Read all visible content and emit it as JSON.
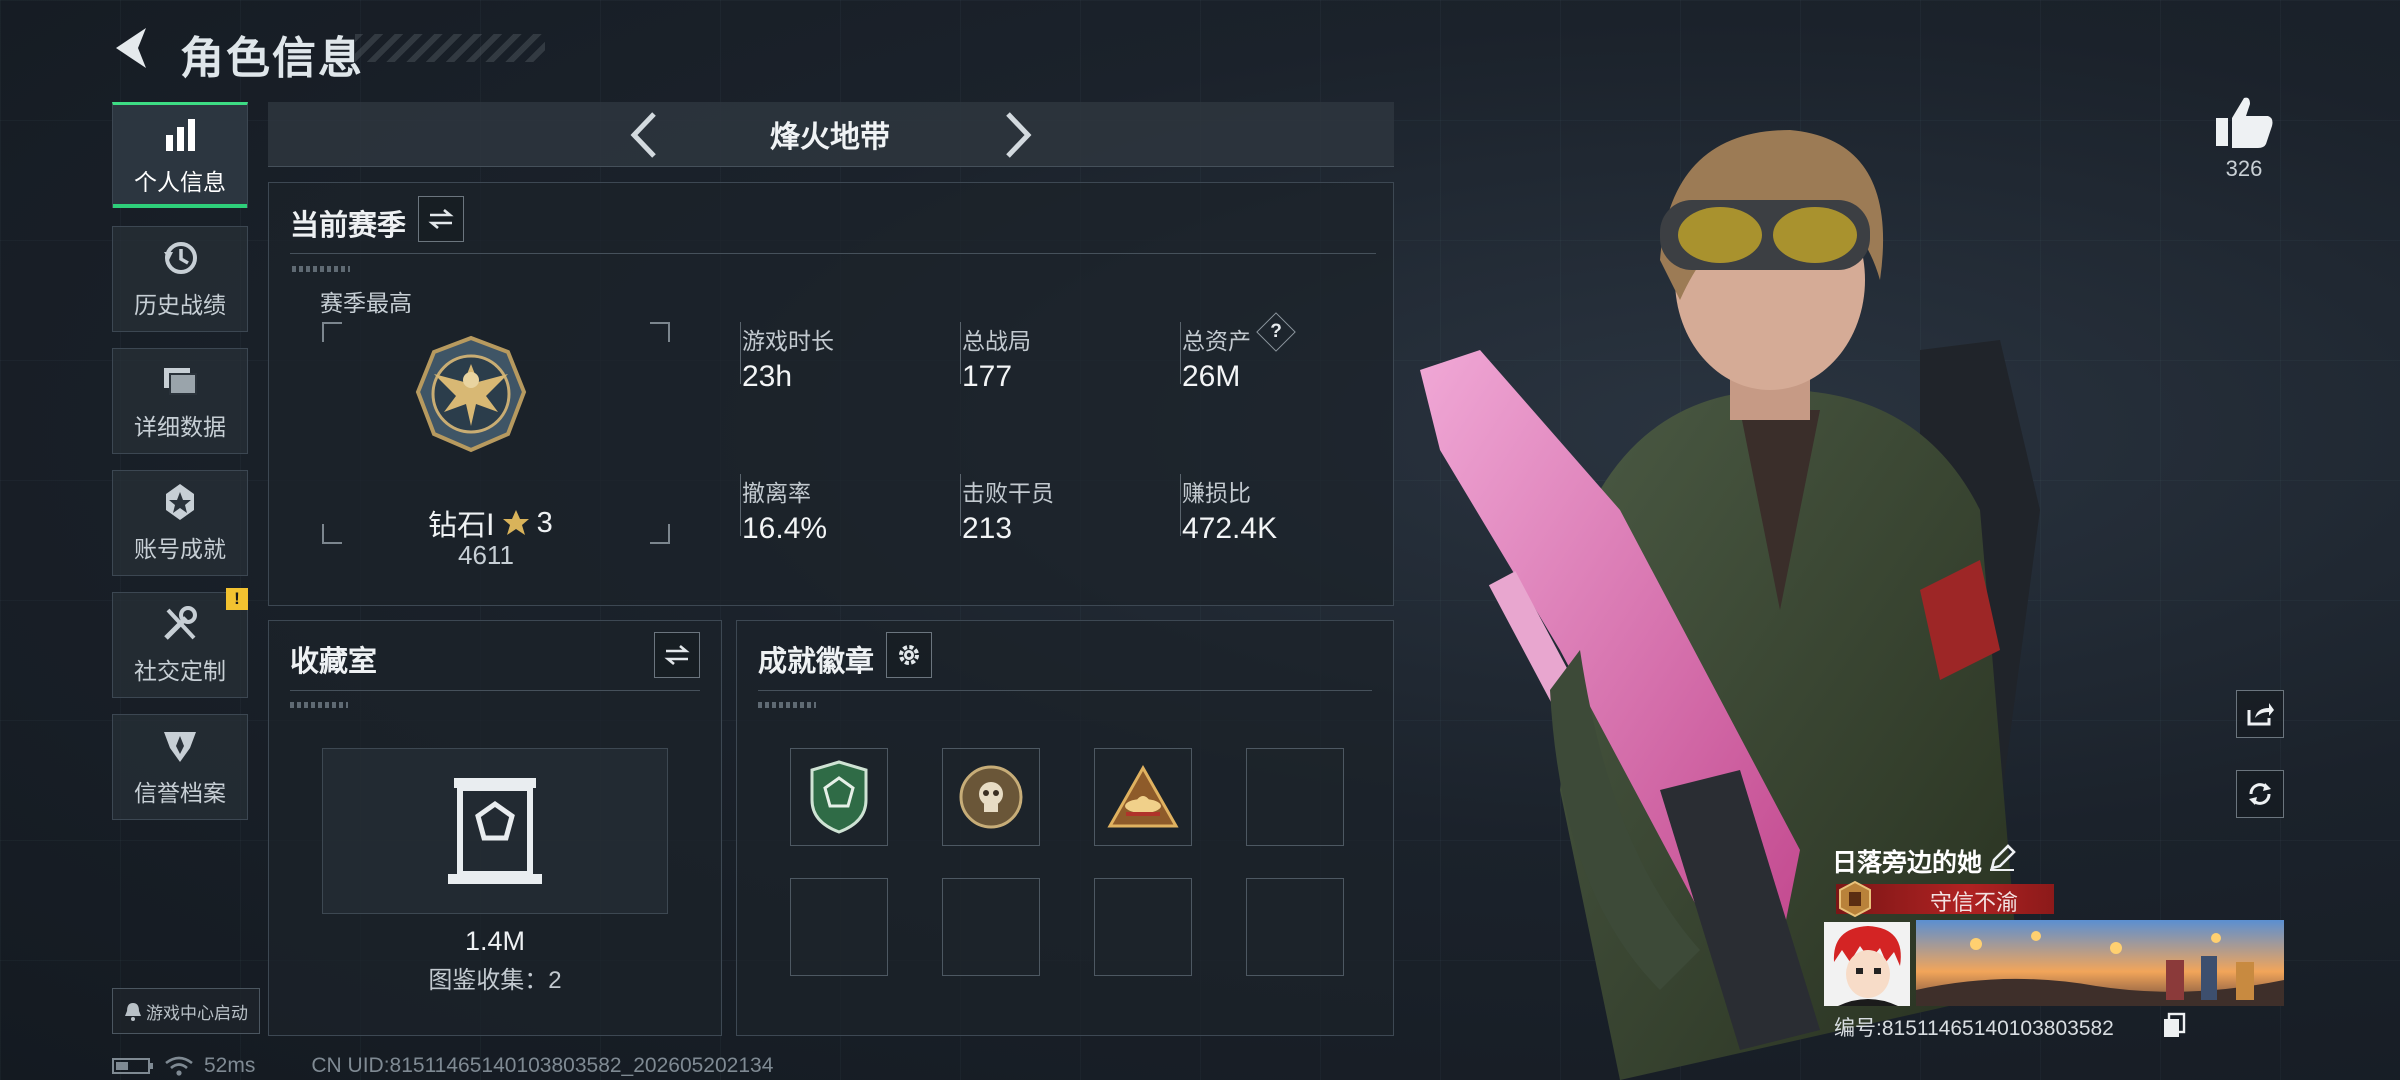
{
  "header": {
    "title": "角色信息"
  },
  "nav": {
    "items": [
      {
        "label": "个人信息",
        "icon": "bar-chart-icon",
        "active": true
      },
      {
        "label": "历史战绩",
        "icon": "history-clock-icon",
        "active": false
      },
      {
        "label": "详细数据",
        "icon": "folder-icon",
        "active": false
      },
      {
        "label": "账号成就",
        "icon": "achievement-star-icon",
        "active": false
      },
      {
        "label": "社交定制",
        "icon": "tools-icon",
        "active": false
      },
      {
        "label": "信誉档案",
        "icon": "credit-shield-icon",
        "active": false
      }
    ],
    "warn_badge": "!"
  },
  "season": {
    "name": "烽火地带"
  },
  "current_season": {
    "title": "当前赛季",
    "best_label": "赛季最高",
    "rank_name": "钻石Ⅰ",
    "rank_stars": "3",
    "rank_score": "4611",
    "stats": [
      {
        "label": "游戏时长",
        "value": "23h"
      },
      {
        "label": "总战局",
        "value": "177"
      },
      {
        "label": "总资产",
        "value": "26M",
        "help": "?"
      },
      {
        "label": "撤离率",
        "value": "16.4%"
      },
      {
        "label": "击败干员",
        "value": "213"
      },
      {
        "label": "赚损比",
        "value": "472.4K"
      }
    ]
  },
  "collection": {
    "title": "收藏室",
    "value": "1.4M",
    "count_label": "图鉴收集：2"
  },
  "badges": {
    "title": "成就徽章",
    "slots": [
      {
        "icon": "green-shield-badge-icon"
      },
      {
        "icon": "skull-medal-badge-icon"
      },
      {
        "icon": "triangle-hat-badge-icon"
      },
      {
        "icon": ""
      },
      {
        "icon": ""
      },
      {
        "icon": ""
      },
      {
        "icon": ""
      },
      {
        "icon": ""
      }
    ]
  },
  "profile": {
    "like_count": "326",
    "name": "日落旁边的她",
    "title_tag": "守信不渝",
    "id_label": "编号:81511465140103803582"
  },
  "footer": {
    "launch_label": "游戏中心启动",
    "ping": "52ms",
    "uid": "CN UID:81511465140103803582_202605202134"
  },
  "colors": {
    "accent_green": "#2ecf7a",
    "warn_yellow": "#f2c230",
    "title_red": "#b02222",
    "background": "#1a2028"
  }
}
